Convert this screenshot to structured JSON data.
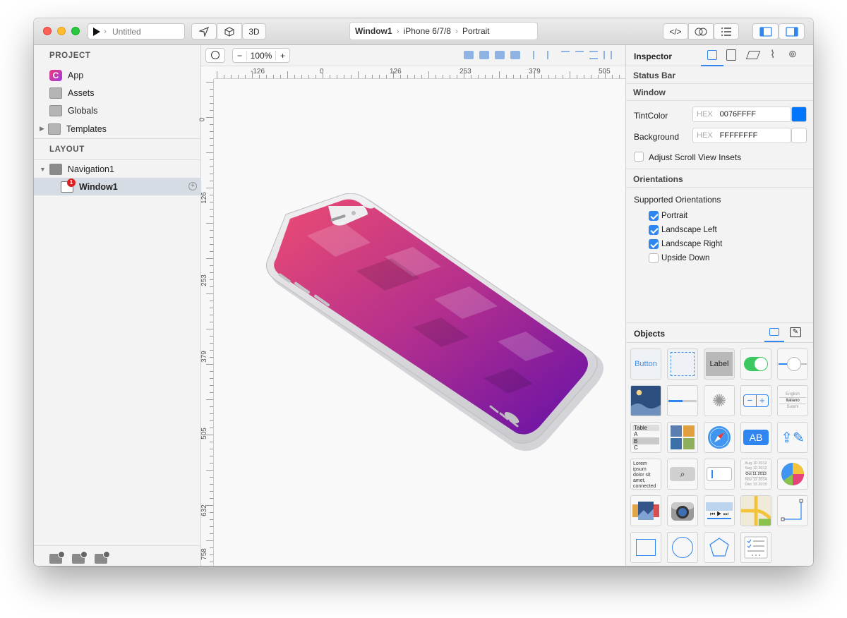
{
  "titlebar": {
    "project_name": "Untitled",
    "mode_3d": "3D",
    "breadcrumb": [
      "Window1",
      "iPhone 6/7/8",
      "Portrait"
    ]
  },
  "sidebar": {
    "project_header": "PROJECT",
    "project_items": [
      {
        "label": "App",
        "icon": "app-icon"
      },
      {
        "label": "Assets",
        "icon": "assets-folder-icon"
      },
      {
        "label": "Globals",
        "icon": "globals-folder-icon"
      },
      {
        "label": "Templates",
        "icon": "templates-folder-icon"
      }
    ],
    "layout_header": "LAYOUT",
    "layout_items": [
      {
        "label": "Navigation1",
        "icon": "navigation-icon"
      },
      {
        "label": "Window1",
        "icon": "window-icon",
        "badge": "1"
      }
    ]
  },
  "canvas": {
    "zoom": "100%",
    "ruler_h": [
      "-126",
      "0",
      "126",
      "253",
      "379",
      "505"
    ],
    "ruler_v": [
      "0",
      "126",
      "253",
      "379",
      "505",
      "632",
      "758"
    ]
  },
  "inspector": {
    "title": "Inspector",
    "status_bar": "Status Bar",
    "window_section": "Window",
    "tint_label": "TintColor",
    "tint_prefix": "HEX",
    "tint_value": "0076FFFF",
    "tint_color": "#0076FF",
    "background_label": "Background",
    "background_prefix": "HEX",
    "background_value": "FFFFFFFF",
    "background_color": "#FFFFFF",
    "adjust_scroll": "Adjust Scroll View Insets",
    "orientations_section": "Orientations",
    "supported_label": "Supported Orientations",
    "orientations": [
      {
        "label": "Portrait",
        "checked": true
      },
      {
        "label": "Landscape Left",
        "checked": true
      },
      {
        "label": "Landscape Right",
        "checked": true
      },
      {
        "label": "Upside Down",
        "checked": false
      }
    ]
  },
  "objects": {
    "title": "Objects",
    "button_label": "Button",
    "label_label": "Label",
    "picker_items": [
      "English",
      "Italiano",
      "Suomi"
    ],
    "table_items": [
      "Table",
      "A",
      "B",
      "C"
    ],
    "lorem": "Lorem ipsum dolor sit amet, connected",
    "date_rows": [
      "Aug 10 2012",
      "Sep 10 2012",
      "Oct 11 2013",
      "Nov 12 2014",
      "Dec 13 2015"
    ]
  },
  "colors": {
    "accent": "#2F86F0",
    "badge": "#E02020",
    "gradient_top": "#E8456E",
    "gradient_bottom": "#6A12A8"
  }
}
